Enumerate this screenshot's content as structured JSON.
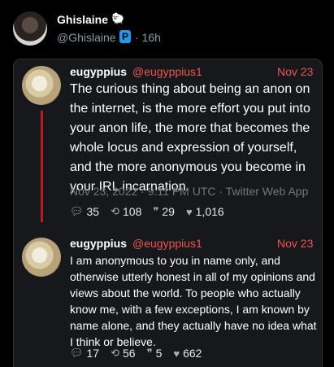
{
  "header": {
    "name": "Ghislaine",
    "name_icon": "🐑",
    "handle": "@Ghislaine",
    "badge": "P",
    "time": "· 16h"
  },
  "tweets": [
    {
      "name": "eugyppius",
      "handle": "@eugyppius1",
      "date": "Nov 23",
      "text": "The curious thing about being an anon on the internet, is the more effort you put into your anon life, the more that becomes the whole locus and expression of yourself, and the more anonymous you become in your IRL incarnation.",
      "meta": "Nov 23, 2022 · 9:11 PM UTC · Twitter Web App",
      "stats": {
        "replies": "35",
        "retweets": "108",
        "quotes": "29",
        "likes": "1,016"
      }
    },
    {
      "name": "eugyppius",
      "handle": "@eugyppius1",
      "date": "Nov 23",
      "text": "I am anonymous to you in name only, and otherwise utterly honest in all of my opinions and views about the world. To people who actually know me, with a few exceptions, I am known by name alone, and they actually have no idea what I think or believe.",
      "stats": {
        "replies": "17",
        "retweets": "56",
        "quotes": "5",
        "likes": "662"
      }
    }
  ],
  "icons": {
    "reply": "comment-icon",
    "retweet": "retweet-icon",
    "quote": "quote-icon",
    "like": "heart-icon"
  },
  "colors": {
    "background": "#000000",
    "card": "#16181c",
    "accent_red": "#f0544f",
    "thread_line": "#c0181e",
    "muted": "#71767b"
  }
}
